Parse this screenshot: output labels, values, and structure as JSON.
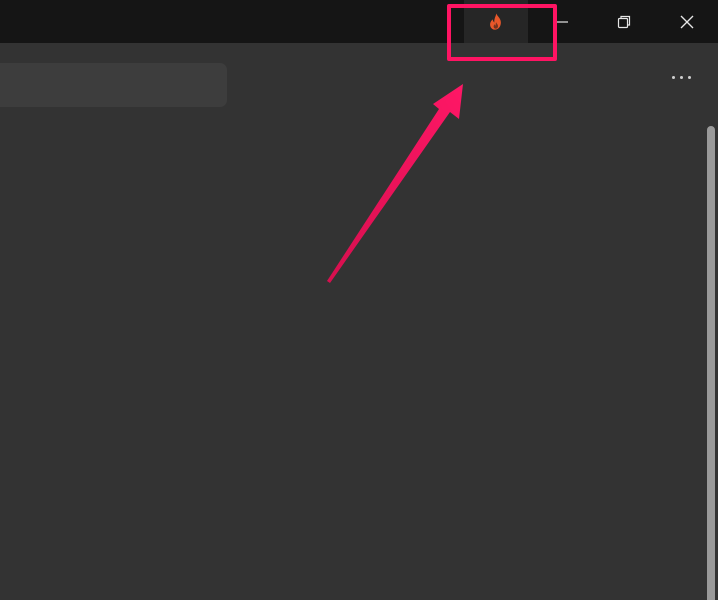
{
  "window": {
    "title_bar": {
      "fire_button_icon": "flame-icon",
      "fire_icon_color": "#e8572a",
      "minimize_icon": "minimize-icon",
      "restore_icon": "restore-icon",
      "close_icon": "close-icon"
    },
    "search": {
      "value": "",
      "placeholder": ""
    },
    "more_button_icon": "more-horizontal-icon"
  },
  "annotation": {
    "highlight_color": "#ff1463",
    "target": "fire-button"
  }
}
